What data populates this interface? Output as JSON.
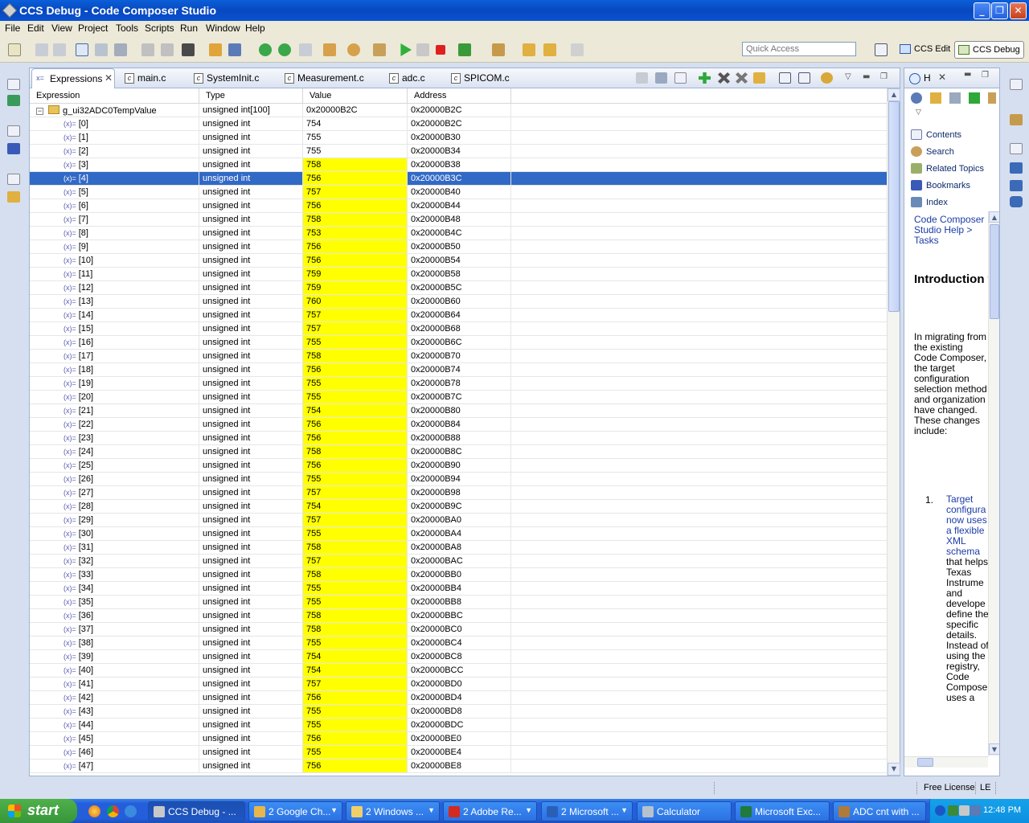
{
  "window": {
    "title": "CCS Debug - Code Composer Studio"
  },
  "menu": [
    "File",
    "Edit",
    "View",
    "Project",
    "Tools",
    "Scripts",
    "Run",
    "Window",
    "Help"
  ],
  "toolbar": {
    "quick_access_placeholder": "Quick Access",
    "perspectives": [
      {
        "label": "CCS Edit",
        "active": false
      },
      {
        "label": "CCS Debug",
        "active": true
      }
    ]
  },
  "tabs": [
    {
      "label": "Expressions",
      "active": true
    },
    {
      "label": "main.c"
    },
    {
      "label": "SystemInit.c"
    },
    {
      "label": "Measurement.c"
    },
    {
      "label": "adc.c"
    },
    {
      "label": "SPICOM.c"
    }
  ],
  "table": {
    "columns": [
      "Expression",
      "Type",
      "Value",
      "Address"
    ],
    "parent": {
      "expression": "g_ui32ADC0TempValue",
      "type": "unsigned int[100]",
      "value": "0x20000B2C",
      "address": "0x20000B2C"
    },
    "selected_index": 4,
    "rows": [
      {
        "expression": "[0]",
        "type": "unsigned int",
        "value": "754",
        "address": "0x20000B2C",
        "changed": false
      },
      {
        "expression": "[1]",
        "type": "unsigned int",
        "value": "755",
        "address": "0x20000B30",
        "changed": false
      },
      {
        "expression": "[2]",
        "type": "unsigned int",
        "value": "755",
        "address": "0x20000B34",
        "changed": false
      },
      {
        "expression": "[3]",
        "type": "unsigned int",
        "value": "758",
        "address": "0x20000B38",
        "changed": true
      },
      {
        "expression": "[4]",
        "type": "unsigned int",
        "value": "756",
        "address": "0x20000B3C",
        "changed": true
      },
      {
        "expression": "[5]",
        "type": "unsigned int",
        "value": "757",
        "address": "0x20000B40",
        "changed": true
      },
      {
        "expression": "[6]",
        "type": "unsigned int",
        "value": "756",
        "address": "0x20000B44",
        "changed": true
      },
      {
        "expression": "[7]",
        "type": "unsigned int",
        "value": "758",
        "address": "0x20000B48",
        "changed": true
      },
      {
        "expression": "[8]",
        "type": "unsigned int",
        "value": "753",
        "address": "0x20000B4C",
        "changed": true
      },
      {
        "expression": "[9]",
        "type": "unsigned int",
        "value": "756",
        "address": "0x20000B50",
        "changed": true
      },
      {
        "expression": "[10]",
        "type": "unsigned int",
        "value": "756",
        "address": "0x20000B54",
        "changed": true
      },
      {
        "expression": "[11]",
        "type": "unsigned int",
        "value": "759",
        "address": "0x20000B58",
        "changed": true
      },
      {
        "expression": "[12]",
        "type": "unsigned int",
        "value": "759",
        "address": "0x20000B5C",
        "changed": true
      },
      {
        "expression": "[13]",
        "type": "unsigned int",
        "value": "760",
        "address": "0x20000B60",
        "changed": true
      },
      {
        "expression": "[14]",
        "type": "unsigned int",
        "value": "757",
        "address": "0x20000B64",
        "changed": true
      },
      {
        "expression": "[15]",
        "type": "unsigned int",
        "value": "757",
        "address": "0x20000B68",
        "changed": true
      },
      {
        "expression": "[16]",
        "type": "unsigned int",
        "value": "755",
        "address": "0x20000B6C",
        "changed": true
      },
      {
        "expression": "[17]",
        "type": "unsigned int",
        "value": "758",
        "address": "0x20000B70",
        "changed": true
      },
      {
        "expression": "[18]",
        "type": "unsigned int",
        "value": "756",
        "address": "0x20000B74",
        "changed": true
      },
      {
        "expression": "[19]",
        "type": "unsigned int",
        "value": "755",
        "address": "0x20000B78",
        "changed": true
      },
      {
        "expression": "[20]",
        "type": "unsigned int",
        "value": "755",
        "address": "0x20000B7C",
        "changed": true
      },
      {
        "expression": "[21]",
        "type": "unsigned int",
        "value": "754",
        "address": "0x20000B80",
        "changed": true
      },
      {
        "expression": "[22]",
        "type": "unsigned int",
        "value": "756",
        "address": "0x20000B84",
        "changed": true
      },
      {
        "expression": "[23]",
        "type": "unsigned int",
        "value": "756",
        "address": "0x20000B88",
        "changed": true
      },
      {
        "expression": "[24]",
        "type": "unsigned int",
        "value": "758",
        "address": "0x20000B8C",
        "changed": true
      },
      {
        "expression": "[25]",
        "type": "unsigned int",
        "value": "756",
        "address": "0x20000B90",
        "changed": true
      },
      {
        "expression": "[26]",
        "type": "unsigned int",
        "value": "755",
        "address": "0x20000B94",
        "changed": true
      },
      {
        "expression": "[27]",
        "type": "unsigned int",
        "value": "757",
        "address": "0x20000B98",
        "changed": true
      },
      {
        "expression": "[28]",
        "type": "unsigned int",
        "value": "754",
        "address": "0x20000B9C",
        "changed": true
      },
      {
        "expression": "[29]",
        "type": "unsigned int",
        "value": "757",
        "address": "0x20000BA0",
        "changed": true
      },
      {
        "expression": "[30]",
        "type": "unsigned int",
        "value": "755",
        "address": "0x20000BA4",
        "changed": true
      },
      {
        "expression": "[31]",
        "type": "unsigned int",
        "value": "758",
        "address": "0x20000BA8",
        "changed": true
      },
      {
        "expression": "[32]",
        "type": "unsigned int",
        "value": "757",
        "address": "0x20000BAC",
        "changed": true
      },
      {
        "expression": "[33]",
        "type": "unsigned int",
        "value": "758",
        "address": "0x20000BB0",
        "changed": true
      },
      {
        "expression": "[34]",
        "type": "unsigned int",
        "value": "755",
        "address": "0x20000BB4",
        "changed": true
      },
      {
        "expression": "[35]",
        "type": "unsigned int",
        "value": "755",
        "address": "0x20000BB8",
        "changed": true
      },
      {
        "expression": "[36]",
        "type": "unsigned int",
        "value": "758",
        "address": "0x20000BBC",
        "changed": true
      },
      {
        "expression": "[37]",
        "type": "unsigned int",
        "value": "758",
        "address": "0x20000BC0",
        "changed": true
      },
      {
        "expression": "[38]",
        "type": "unsigned int",
        "value": "755",
        "address": "0x20000BC4",
        "changed": true
      },
      {
        "expression": "[39]",
        "type": "unsigned int",
        "value": "754",
        "address": "0x20000BC8",
        "changed": true
      },
      {
        "expression": "[40]",
        "type": "unsigned int",
        "value": "754",
        "address": "0x20000BCC",
        "changed": true
      },
      {
        "expression": "[41]",
        "type": "unsigned int",
        "value": "757",
        "address": "0x20000BD0",
        "changed": true
      },
      {
        "expression": "[42]",
        "type": "unsigned int",
        "value": "756",
        "address": "0x20000BD4",
        "changed": true
      },
      {
        "expression": "[43]",
        "type": "unsigned int",
        "value": "755",
        "address": "0x20000BD8",
        "changed": true
      },
      {
        "expression": "[44]",
        "type": "unsigned int",
        "value": "755",
        "address": "0x20000BDC",
        "changed": true
      },
      {
        "expression": "[45]",
        "type": "unsigned int",
        "value": "756",
        "address": "0x20000BE0",
        "changed": true
      },
      {
        "expression": "[46]",
        "type": "unsigned int",
        "value": "755",
        "address": "0x20000BE4",
        "changed": true
      },
      {
        "expression": "[47]",
        "type": "unsigned int",
        "value": "756",
        "address": "0x20000BE8",
        "changed": true
      }
    ]
  },
  "help": {
    "tab_label": "H",
    "links": [
      "Contents",
      "Search",
      "Related Topics",
      "Bookmarks",
      "Index"
    ],
    "breadcrumb": "Code Composer Studio Help > Tasks",
    "heading": "Introduction to target configuration",
    "paragraph": "In migrating from the existing Code Composer, the target configuration selection method and organization have changed. These changes include:",
    "list_number": "1.",
    "list_link": "Target configura now uses a flexible XML schema",
    "list_text": "that helps Texas Instrume and develope define the specific details. Instead of using the registry, Code Compose uses a"
  },
  "status": {
    "license": "Free License",
    "mode": "LE"
  },
  "taskbar": {
    "start_label": "start",
    "tasks": [
      {
        "label": "CCS Debug - ...",
        "active": true,
        "icon_color": "#c8c8c8"
      },
      {
        "label": "2 Google Ch...",
        "active": false,
        "icon_color": "#e8b64a",
        "group": true
      },
      {
        "label": "2 Windows ...",
        "active": false,
        "icon_color": "#f1cf68",
        "group": true
      },
      {
        "label": "2 Adobe Re...",
        "active": false,
        "icon_color": "#d42a1f",
        "group": true
      },
      {
        "label": "2 Microsoft ...",
        "active": false,
        "icon_color": "#2a5fb8",
        "group": true
      },
      {
        "label": "Calculator",
        "active": false,
        "icon_color": "#b7c2cc"
      },
      {
        "label": "Microsoft Exc...",
        "active": false,
        "icon_color": "#1f7a3b"
      },
      {
        "label": "ADC cnt with ...",
        "active": false,
        "icon_color": "#b07a3a"
      }
    ],
    "clock": "12:48 PM"
  }
}
